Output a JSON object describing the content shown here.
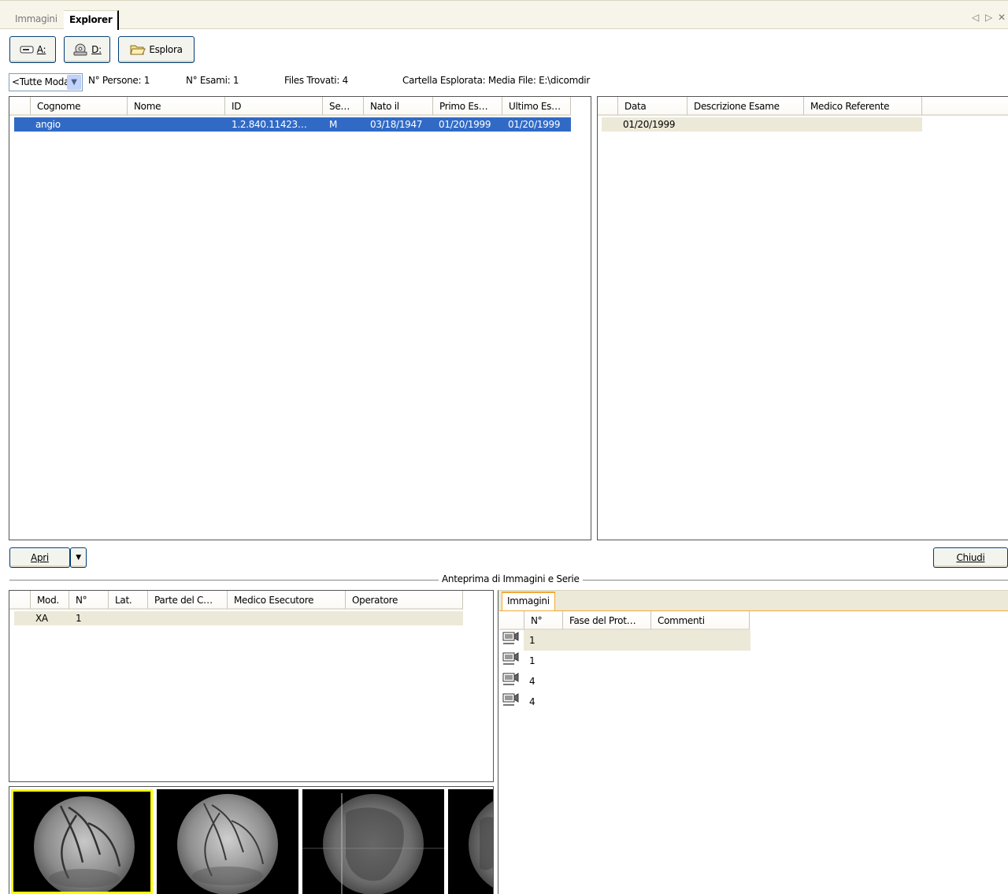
{
  "tabs": {
    "inactive": "Immagini",
    "active": "Explorer"
  },
  "window_nav": {
    "prev": "◁",
    "next": "▷",
    "close": "✕"
  },
  "toolbar": {
    "drive_a": "A:",
    "drive_d": "D:",
    "explore": "Esplora"
  },
  "filter": {
    "modality_combo": "<Tutte Modalità>",
    "persons": "N° Persone: 1",
    "exams": "N° Esami: 1",
    "files": "Files Trovati: 4",
    "folder": "Cartella Esplorata: Media File: E:\\dicomdir"
  },
  "patients": {
    "columns": [
      "Cognome",
      "Nome",
      "ID",
      "Se…",
      "Nato il",
      "Primo Es…",
      "Ultimo Es…"
    ],
    "rows": [
      {
        "cognome": "angio",
        "nome": "",
        "id": "1.2.840.11423…",
        "sesso": "M",
        "nato": "03/18/1947",
        "primo": "01/20/1999",
        "ultimo": "01/20/1999"
      }
    ]
  },
  "exams": {
    "columns": [
      "Data",
      "Descrizione Esame",
      "Medico Referente"
    ],
    "rows": [
      {
        "data": "01/20/1999",
        "descrizione": "",
        "medico": ""
      }
    ]
  },
  "buttons": {
    "open": "Apri",
    "close": "Chiudi"
  },
  "group_caption": "Anteprima di Immagini e Serie",
  "series": {
    "columns": [
      "Mod.",
      "N°",
      "Lat.",
      "Parte del C…",
      "Medico Esecutore",
      "Operatore"
    ],
    "rows": [
      {
        "mod": "XA",
        "n": "1"
      }
    ]
  },
  "images_tab": "Immagini",
  "images": {
    "columns": [
      "N°",
      "Fase del Prot…",
      "Commenti"
    ],
    "rows": [
      {
        "n": "1"
      },
      {
        "n": "1"
      },
      {
        "n": "4"
      },
      {
        "n": "4"
      }
    ]
  },
  "colors": {
    "selection": "#316ac5",
    "thumb_selected_border": "#ffff00",
    "tab_accent": "#f0a93a"
  }
}
